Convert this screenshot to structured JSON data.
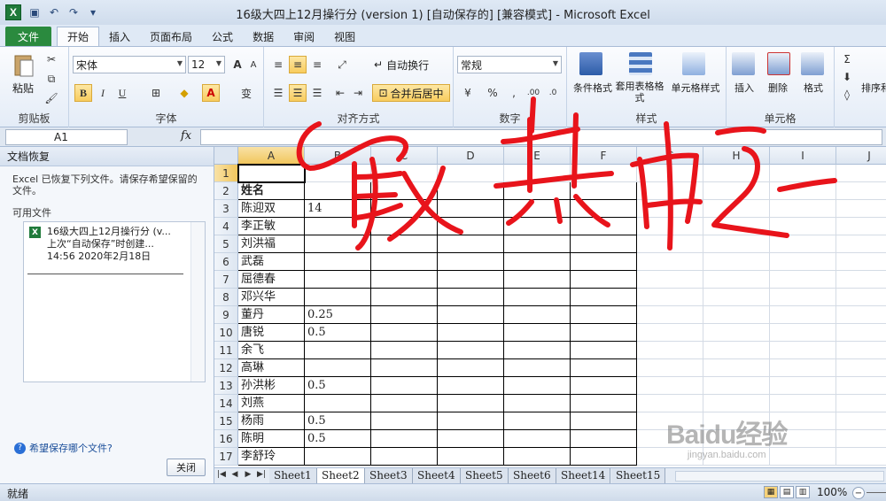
{
  "window": {
    "title": "16级大四上12月操行分 (version 1) [自动保存的]  [兼容模式] - Microsoft Excel",
    "app_icon": "X"
  },
  "tabs": {
    "file": "文件",
    "items": [
      "开始",
      "插入",
      "页面布局",
      "公式",
      "数据",
      "审阅",
      "视图"
    ]
  },
  "ribbon": {
    "clipboard": {
      "label": "剪贴板",
      "paste": "粘贴"
    },
    "font": {
      "label": "字体",
      "name": "宋体",
      "size": "12",
      "bold": "B",
      "italic": "I",
      "underline": "U",
      "grow": "A",
      "shrink": "A",
      "wen": "变"
    },
    "alignment": {
      "label": "对齐方式",
      "wrap": "自动换行",
      "merge": "合并后居中"
    },
    "number": {
      "label": "数字",
      "format": "常规"
    },
    "styles": {
      "label": "样式",
      "conditional": "条件格式",
      "table": "套用表格格式",
      "cell_styles": "单元格样式"
    },
    "cells": {
      "label": "单元格",
      "insert": "插入",
      "delete": "删除",
      "format": "格式"
    },
    "editing": {
      "sort": "排序和"
    }
  },
  "formula_bar": {
    "name_box": "A1",
    "fx": "fx",
    "value": ""
  },
  "recovery": {
    "title": "文档恢复",
    "description": "Excel 已恢复下列文件。请保存希望保留的文件。",
    "available": "可用文件",
    "file_line1": "16级大四上12月操行分 (v...",
    "file_line2": "上次“自动保存”时创建...",
    "file_line3": "14:56 2020年2月18日",
    "help": "希望保存哪个文件?",
    "close": "关闭"
  },
  "columns": [
    "A",
    "B",
    "C",
    "D",
    "E",
    "F",
    "G",
    "H",
    "I",
    "J"
  ],
  "rows": [
    {
      "n": "1",
      "a": "",
      "b": ""
    },
    {
      "n": "2",
      "a": "姓名",
      "b": ""
    },
    {
      "n": "3",
      "a": "陈迎双",
      "b": "14"
    },
    {
      "n": "4",
      "a": "李正敏",
      "b": ""
    },
    {
      "n": "5",
      "a": "刘洪福",
      "b": ""
    },
    {
      "n": "6",
      "a": "武磊",
      "b": ""
    },
    {
      "n": "7",
      "a": "屈德春",
      "b": ""
    },
    {
      "n": "8",
      "a": "邓兴华",
      "b": ""
    },
    {
      "n": "9",
      "a": "董丹",
      "b": "0.25"
    },
    {
      "n": "10",
      "a": "唐锐",
      "b": "0.5"
    },
    {
      "n": "11",
      "a": "余飞",
      "b": ""
    },
    {
      "n": "12",
      "a": "高琳",
      "b": ""
    },
    {
      "n": "13",
      "a": "孙洪彬",
      "b": "0.5"
    },
    {
      "n": "14",
      "a": "刘燕",
      "b": ""
    },
    {
      "n": "15",
      "a": "杨雨",
      "b": "0.5"
    },
    {
      "n": "16",
      "a": "陈明",
      "b": "0.5"
    },
    {
      "n": "17",
      "a": "李舒玲",
      "b": ""
    }
  ],
  "sheet_tabs": [
    "Sheet1",
    "Sheet2",
    "Sheet3",
    "Sheet4",
    "Sheet5",
    "Sheet6",
    "Sheet14",
    "Sheet15"
  ],
  "active_sheet": "Sheet2",
  "status": {
    "ready": "就绪",
    "zoom": "100%"
  },
  "watermark": {
    "logo": "Baidu经验",
    "sub": "jingyan.baidu.com"
  },
  "colors": {
    "file_tab": "#2a8a3e",
    "accent": "#f1c65d",
    "scribble": "#e8141b"
  }
}
